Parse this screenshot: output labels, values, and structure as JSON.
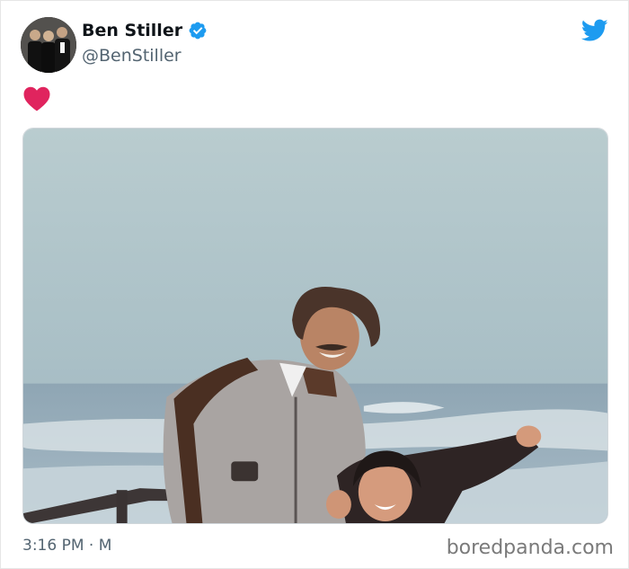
{
  "tweet": {
    "display_name": "Ben Stiller",
    "handle": "@BenStiller",
    "verified": true,
    "text_emoji": "red-heart",
    "timestamp": "3:16 PM · M",
    "media_alt": "Vintage photo of a man in a tan track jacket and a smiling child waving on a seaside deck"
  },
  "icons": {
    "verified": "verified-badge-icon",
    "brand": "twitter-bird-icon",
    "heart": "heart-icon"
  },
  "watermark": "boredpanda.com",
  "colors": {
    "verified_blue": "#1d9bf0",
    "twitter_blue": "#1d9bf0",
    "heart_red": "#e0245e",
    "muted_text": "#536471"
  }
}
